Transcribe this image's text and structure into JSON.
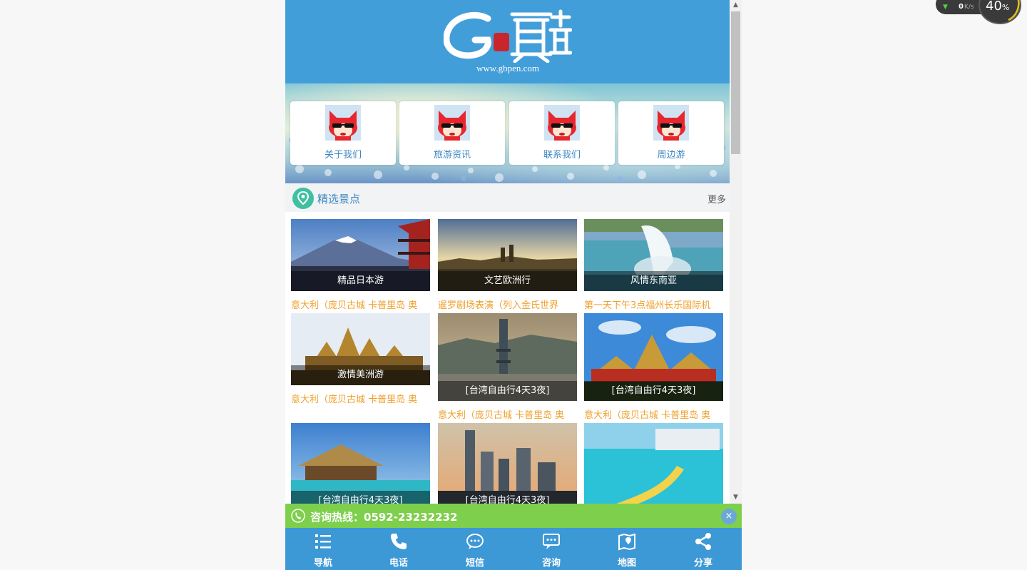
{
  "header": {
    "logo_url": "www.gbpen.com"
  },
  "nav_cards": [
    {
      "label": "关于我们"
    },
    {
      "label": "旅游资讯"
    },
    {
      "label": "联系我们"
    },
    {
      "label": "周边游"
    }
  ],
  "section": {
    "title": "精选景点",
    "more": "更多"
  },
  "tiles": [
    {
      "caption": "精品日本游",
      "desc": "意大利（庞贝古城 卡普里岛 奥"
    },
    {
      "caption": "文艺欧洲行",
      "desc": "暹罗剧场表演（列入金氏世界"
    },
    {
      "caption": "风情东南亚",
      "desc": "第一天下午3点福州长乐国际机"
    },
    {
      "caption": "激情美洲游",
      "desc": "意大利（庞贝古城 卡普里岛 奥"
    },
    {
      "caption": "[台湾自由行4天3夜]",
      "desc": "意大利（庞贝古城 卡普里岛 奥"
    },
    {
      "caption": "[台湾自由行4天3夜]",
      "desc": "意大利（庞贝古城 卡普里岛 奥"
    },
    {
      "caption": "[台湾自由行4天3夜]",
      "desc": ""
    },
    {
      "caption": "[台湾自由行4天3夜]",
      "desc": ""
    },
    {
      "caption": "",
      "desc": ""
    }
  ],
  "hotline": {
    "text": "咨询热线：0592-23232232",
    "close": "×"
  },
  "toolbar": [
    {
      "label": "导航",
      "icon": "list-icon"
    },
    {
      "label": "电话",
      "icon": "phone-icon"
    },
    {
      "label": "短信",
      "icon": "sms-icon"
    },
    {
      "label": "咨询",
      "icon": "chat-icon"
    },
    {
      "label": "地图",
      "icon": "map-icon"
    },
    {
      "label": "分享",
      "icon": "share-icon"
    }
  ],
  "speed_widget": {
    "speed": "0",
    "unit": "K/s",
    "percent": "40",
    "percent_sign": "%"
  },
  "colors": {
    "header": "#429ed9",
    "hotline": "#7ecf4c",
    "toolbar": "#3d98d6",
    "desc": "#f0a02a",
    "link": "#3a86c3"
  }
}
